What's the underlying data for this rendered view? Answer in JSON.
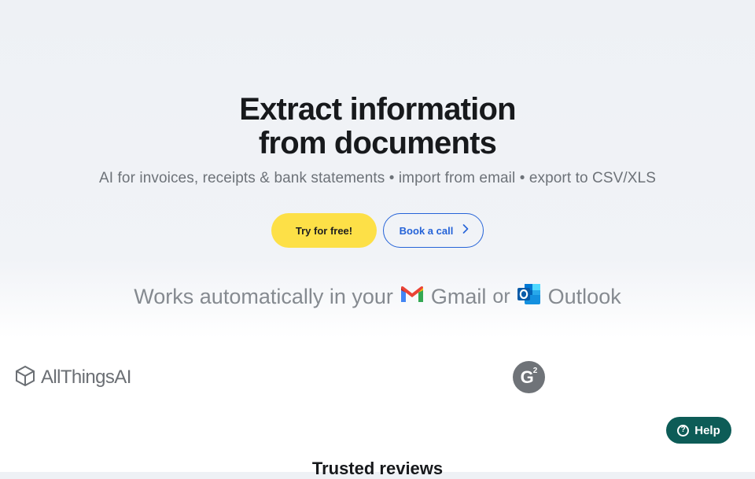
{
  "hero": {
    "title_line1": "Extract information",
    "title_line2": "from documents",
    "subtitle": "AI for invoices, receipts & bank statements • import from email • export to CSV/XLS"
  },
  "cta": {
    "try_label": "Try for free!",
    "call_label": "Book a call",
    "call_icon": "chevron-right-icon"
  },
  "integrations": {
    "prefix": "Works automatically in your",
    "gmail_label": "Gmail",
    "connector": "or",
    "outlook_label": "Outlook",
    "gmail_icon": "gmail-icon",
    "outlook_icon": "outlook-icon"
  },
  "logos": {
    "allthingsai": "AllThingsAI",
    "g2": "G"
  },
  "help": {
    "label": "Help",
    "icon": "question-circle-icon"
  },
  "reviews": {
    "heading": "Trusted reviews"
  },
  "colors": {
    "primary_button": "#fde047",
    "link_blue": "#2563d8",
    "help_bg": "#0d5c57",
    "muted_text": "#858a90"
  }
}
